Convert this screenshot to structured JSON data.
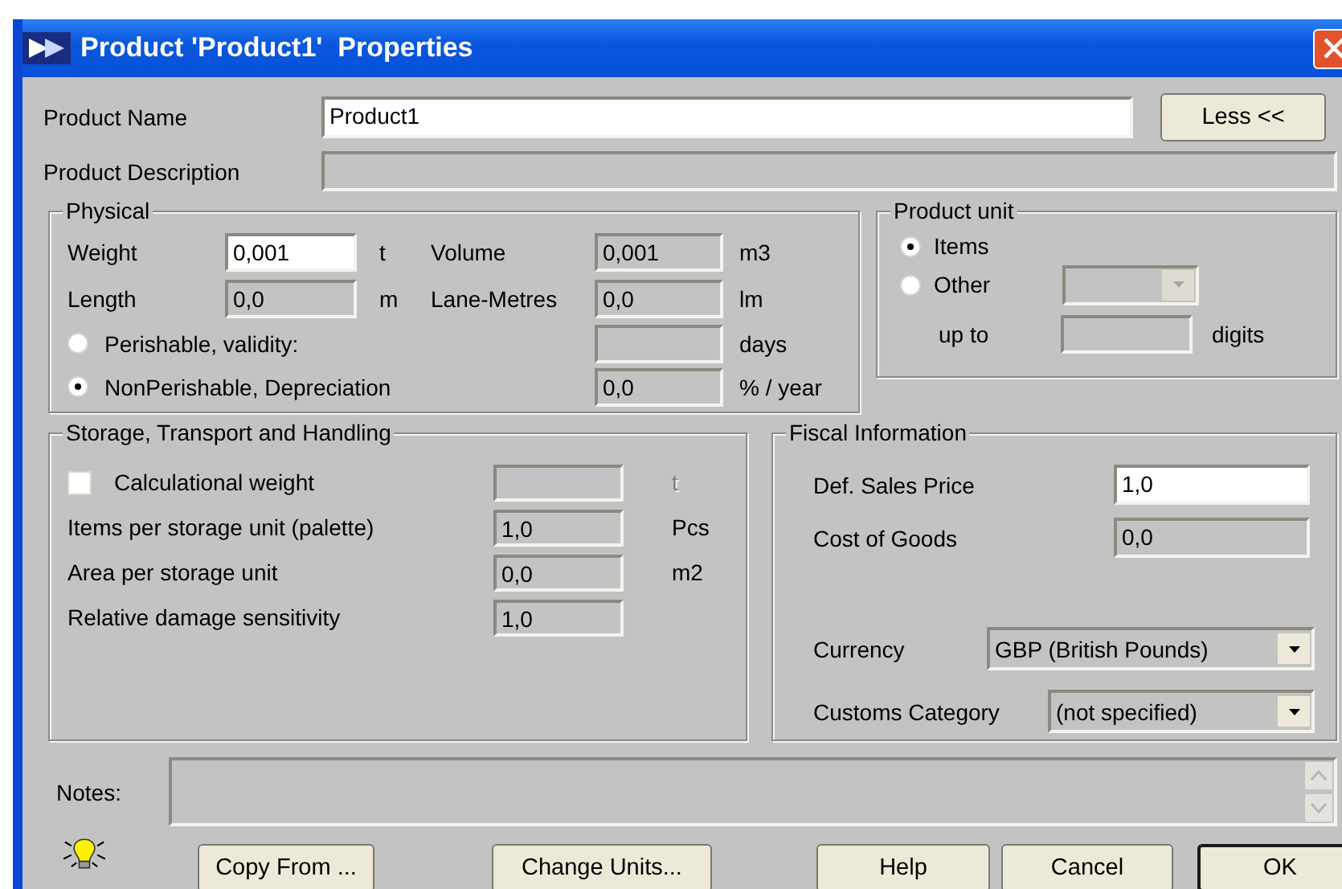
{
  "window": {
    "title": "Product 'Product1'  Properties"
  },
  "product_name": {
    "label": "Product Name",
    "value": "Product1",
    "disabled": false
  },
  "less_button": {
    "label": "Less <<"
  },
  "product_description": {
    "label": "Product Description",
    "disabled": true
  },
  "physical": {
    "title": "Physical",
    "rows": [
      {
        "kind": "pair",
        "label": "Weight",
        "value": "0,001",
        "unit": "t",
        "disabled": false,
        "second": {
          "label": "Volume",
          "value": "0,001",
          "unit": "m3",
          "disabled": true
        }
      },
      {
        "kind": "pair",
        "label": "Length",
        "value": "0,0",
        "unit": "m",
        "disabled": true,
        "second": {
          "label": "Lane-Metres",
          "value": "0,0",
          "unit": "lm",
          "disabled": true
        }
      },
      {
        "kind": "radio",
        "label": "Perishable, validity:",
        "selected": false,
        "field": {
          "unit": "days",
          "disabled": true
        }
      },
      {
        "kind": "radio",
        "label": "NonPerishable, Depreciation",
        "selected": true,
        "field": {
          "value": "0,0",
          "unit": "% / year",
          "disabled": true
        }
      }
    ]
  },
  "product_unit": {
    "title": "Product unit",
    "options": [
      {
        "label": "Items",
        "selected": true
      },
      {
        "label": "Other",
        "selected": false
      }
    ],
    "other_combo": {
      "disabled": true
    },
    "digits": {
      "label": "up to",
      "unit": "digits",
      "disabled": true
    }
  },
  "storage": {
    "title": "Storage, Transport and Handling",
    "rows": [
      {
        "kind": "checkbox",
        "label": "Calculational weight",
        "checked": false,
        "unit": "t",
        "unit_disabled": true,
        "disabled": true
      },
      {
        "kind": "field",
        "label": "Items per storage unit (palette)",
        "value": "1,0",
        "unit": "Pcs",
        "disabled": true
      },
      {
        "kind": "field",
        "label": "Area per storage unit",
        "value": "0,0",
        "unit": "m2",
        "disabled": true
      },
      {
        "kind": "field",
        "label": "Relative damage sensitivity",
        "value": "1,0",
        "disabled": true
      }
    ]
  },
  "fiscal": {
    "title": "Fiscal Information",
    "rows": [
      {
        "kind": "field",
        "label": "Def. Sales Price",
        "value": "1,0",
        "disabled": false
      },
      {
        "kind": "field",
        "label": "Cost of Goods",
        "value": "0,0",
        "disabled": true
      },
      {
        "kind": "combo",
        "label": "Currency",
        "value": "GBP (British Pounds)"
      },
      {
        "kind": "combo",
        "label": "Customs Category",
        "value": "(not specified)"
      }
    ]
  },
  "notes": {
    "label": "Notes:",
    "disabled": true
  },
  "buttons": [
    {
      "label": "Copy From ...",
      "default": false
    },
    {
      "label": "Change Units...",
      "default": false
    },
    {
      "label": "Help",
      "default": false
    },
    {
      "label": "Cancel",
      "default": false
    },
    {
      "label": "OK",
      "default": true
    }
  ]
}
